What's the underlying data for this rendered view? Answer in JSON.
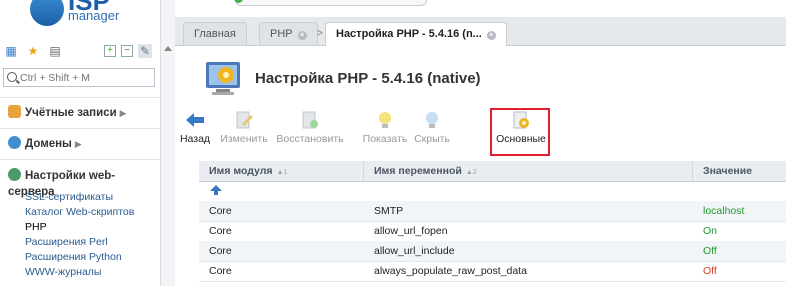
{
  "logo": {
    "big": "ISP",
    "small": "manager"
  },
  "search": {
    "placeholder": "Ctrl + Shift + M"
  },
  "nav": {
    "accounts": "Учётные записи",
    "domains": "Домены",
    "webserver": "Настройки web-сервера",
    "items": [
      "SSL-сертификаты",
      "Каталог Web-скриптов",
      "PHP",
      "Расширения Perl",
      "Расширения Python",
      "WWW-журналы"
    ]
  },
  "tabs": [
    {
      "label": "Главная"
    },
    {
      "label": "PHP"
    },
    {
      "label": "Настройка PHP - 5.4.16 (n..."
    }
  ],
  "page_title": "Настройка PHP - 5.4.16 (native)",
  "toolbar": {
    "back": "Назад",
    "edit": "Изменить",
    "restore": "Восстановить",
    "show": "Показать",
    "hide": "Скрыть",
    "basic": "Основные"
  },
  "table": {
    "headers": [
      "Имя модуля",
      "Имя переменной",
      "Значение"
    ],
    "sort_marks": [
      "▲1",
      "▲2"
    ],
    "rows": [
      {
        "module": "Core",
        "variable": "SMTP",
        "value": "localhost",
        "status": "green"
      },
      {
        "module": "Core",
        "variable": "allow_url_fopen",
        "value": "On",
        "status": "green"
      },
      {
        "module": "Core",
        "variable": "allow_url_include",
        "value": "Off",
        "status": "green"
      },
      {
        "module": "Core",
        "variable": "always_populate_raw_post_data",
        "value": "Off",
        "status": "red"
      }
    ]
  },
  "colors": {
    "accent": "#2c6fb5",
    "highlight": "#e0202a",
    "green": "#1f9a2c",
    "red": "#d83a2a"
  }
}
